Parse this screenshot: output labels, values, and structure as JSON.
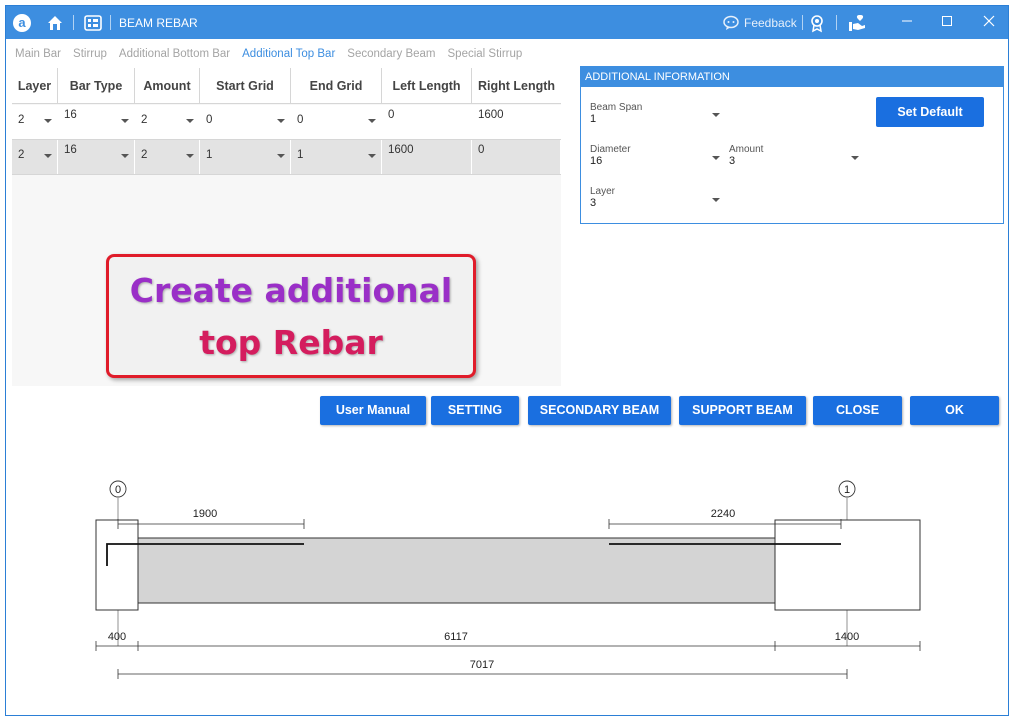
{
  "app": {
    "title": "BEAM REBAR",
    "feedback_label": "Feedback",
    "logo_letter": "a"
  },
  "tabs": [
    {
      "label": "Main Bar",
      "active": false
    },
    {
      "label": "Stirrup",
      "active": false
    },
    {
      "label": "Additional Bottom Bar",
      "active": false
    },
    {
      "label": "Additional Top Bar",
      "active": true
    },
    {
      "label": "Secondary Beam",
      "active": false
    },
    {
      "label": "Special Stirrup",
      "active": false
    }
  ],
  "grid": {
    "headers": [
      "Layer",
      "Bar Type",
      "Amount",
      "Start Grid",
      "End Grid",
      "Left Length",
      "Right Length"
    ],
    "rows": [
      [
        "2",
        "16",
        "2",
        "0",
        "0",
        "0",
        "1600"
      ],
      [
        "2",
        "16",
        "2",
        "1",
        "1",
        "1600",
        "0"
      ]
    ]
  },
  "callout": {
    "line1": "Create additional",
    "line2": "top Rebar"
  },
  "info": {
    "title": "ADDITIONAL INFORMATION",
    "beam_span_label": "Beam Span",
    "beam_span_value": "1",
    "diameter_label": "Diameter",
    "diameter_value": "16",
    "amount_label": "Amount",
    "amount_value": "3",
    "layer_label": "Layer",
    "layer_value": "3",
    "set_default_label": "Set Default"
  },
  "buttons": {
    "user_manual": "User Manual",
    "setting": "SETTING",
    "secondary_beam": "SECONDARY BEAM",
    "support_beam": "SUPPORT BEAM",
    "close": "CLOSE",
    "ok": "OK"
  },
  "drawing": {
    "grid_labels": [
      "0",
      "1"
    ],
    "top_dims": [
      "1900",
      "2240"
    ],
    "bottom_dims": [
      "400",
      "6117",
      "1400"
    ],
    "total_dim": "7017"
  },
  "colors": {
    "accent": "#3d8ee0",
    "button": "#1a6fe0",
    "callout_border": "#e01c2a",
    "callout_line1": "#9a2fc7",
    "callout_line2": "#d41d5e"
  }
}
